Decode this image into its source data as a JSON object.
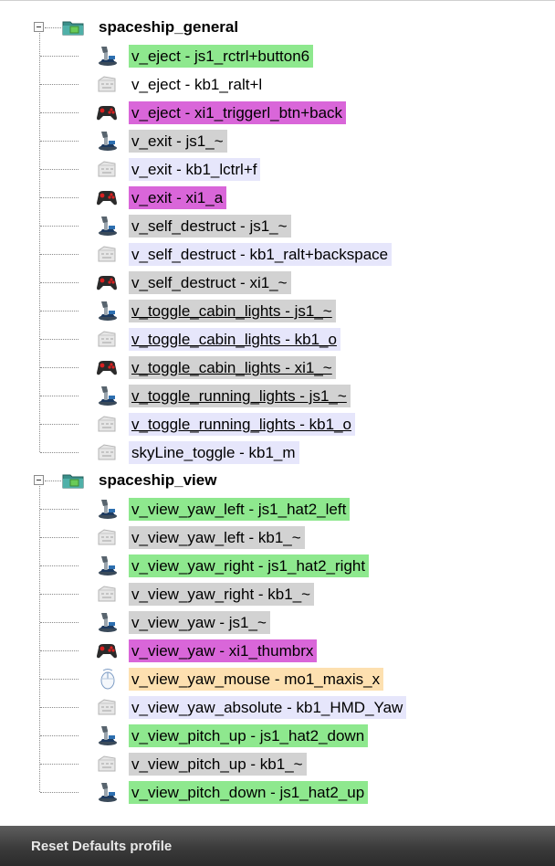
{
  "colors": {
    "bound_js": "#8ee88e",
    "bound_xi": "#d966d9",
    "default_gray": "#d2d2d2",
    "keyboard_lavender": "#e6e6fb",
    "mouse_peach": "#fde0b0",
    "status_bar": "#3b3b3b"
  },
  "tree": {
    "groups": [
      {
        "label": "spaceship_general",
        "icon": "folder-icon",
        "items": [
          {
            "label": "v_eject - js1_rctrl+button6",
            "device": "joystick",
            "style": "bound_js",
            "underline": false
          },
          {
            "label": "v_eject - kb1_ralt+l",
            "device": "keyboard",
            "style": "plain",
            "underline": false
          },
          {
            "label": "v_eject - xi1_triggerl_btn+back",
            "device": "gamepad",
            "style": "bound_xi",
            "underline": false
          },
          {
            "label": "v_exit - js1_~",
            "device": "joystick",
            "style": "default_gray",
            "underline": false
          },
          {
            "label": "v_exit - kb1_lctrl+f",
            "device": "keyboard",
            "style": "keyboard_lavender",
            "underline": false
          },
          {
            "label": "v_exit - xi1_a",
            "device": "gamepad",
            "style": "bound_xi",
            "underline": false
          },
          {
            "label": "v_self_destruct - js1_~",
            "device": "joystick",
            "style": "default_gray",
            "underline": false
          },
          {
            "label": "v_self_destruct - kb1_ralt+backspace",
            "device": "keyboard",
            "style": "keyboard_lavender",
            "underline": false
          },
          {
            "label": "v_self_destruct - xi1_~",
            "device": "gamepad",
            "style": "default_gray",
            "underline": false
          },
          {
            "label": "v_toggle_cabin_lights - js1_~",
            "device": "joystick",
            "style": "default_gray",
            "underline": true
          },
          {
            "label": "v_toggle_cabin_lights - kb1_o",
            "device": "keyboard",
            "style": "keyboard_lavender",
            "underline": true
          },
          {
            "label": "v_toggle_cabin_lights - xi1_~",
            "device": "gamepad",
            "style": "default_gray",
            "underline": true
          },
          {
            "label": "v_toggle_running_lights - js1_~",
            "device": "joystick",
            "style": "default_gray",
            "underline": true
          },
          {
            "label": "v_toggle_running_lights - kb1_o",
            "device": "keyboard",
            "style": "keyboard_lavender",
            "underline": true
          },
          {
            "label": "skyLine_toggle - kb1_m",
            "device": "keyboard",
            "style": "keyboard_lavender",
            "underline": false
          }
        ]
      },
      {
        "label": "spaceship_view",
        "icon": "folder-icon",
        "items": [
          {
            "label": "v_view_yaw_left - js1_hat2_left",
            "device": "joystick",
            "style": "bound_js",
            "underline": false
          },
          {
            "label": "v_view_yaw_left - kb1_~",
            "device": "keyboard",
            "style": "default_gray",
            "underline": false
          },
          {
            "label": "v_view_yaw_right - js1_hat2_right",
            "device": "joystick",
            "style": "bound_js",
            "underline": false
          },
          {
            "label": "v_view_yaw_right - kb1_~",
            "device": "keyboard",
            "style": "default_gray",
            "underline": false
          },
          {
            "label": "v_view_yaw - js1_~",
            "device": "joystick",
            "style": "default_gray",
            "underline": false
          },
          {
            "label": "v_view_yaw - xi1_thumbrx",
            "device": "gamepad",
            "style": "bound_xi",
            "underline": false
          },
          {
            "label": "v_view_yaw_mouse - mo1_maxis_x",
            "device": "mouse",
            "style": "mouse_peach",
            "underline": false
          },
          {
            "label": "v_view_yaw_absolute - kb1_HMD_Yaw",
            "device": "keyboard",
            "style": "keyboard_lavender",
            "underline": false
          },
          {
            "label": "v_view_pitch_up - js1_hat2_down",
            "device": "joystick",
            "style": "bound_js",
            "underline": false
          },
          {
            "label": "v_view_pitch_up - kb1_~",
            "device": "keyboard",
            "style": "default_gray",
            "underline": false
          },
          {
            "label": "v_view_pitch_down - js1_hat2_up",
            "device": "joystick",
            "style": "bound_js",
            "underline": false
          }
        ]
      }
    ]
  },
  "status_bar": {
    "text": "Reset Defaults profile"
  }
}
